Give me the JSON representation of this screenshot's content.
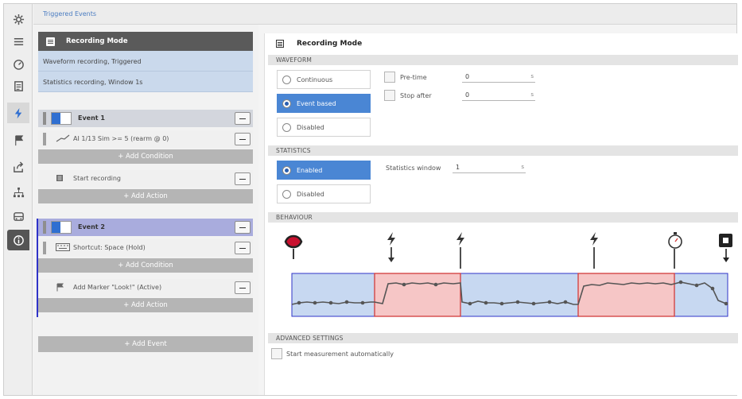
{
  "breadcrumb": "Triggered Events",
  "rail": {
    "icons": [
      "gear-icon",
      "list-icon",
      "gauge-icon",
      "document-icon",
      "bolt-icon",
      "flag-icon",
      "export-icon",
      "network-icon",
      "car-icon",
      "info-icon"
    ]
  },
  "left": {
    "recording_mode": {
      "title": "Recording Mode",
      "rows": [
        "Waveform recording, Triggered",
        "Statistics recording, Window 1s"
      ]
    },
    "events": [
      {
        "title": "Event 1",
        "condition": "AI 1/13 Sim >= 5 (rearm @ 0)",
        "add_condition": "+ Add Condition",
        "action": "Start recording",
        "add_action": "+ Add Action"
      },
      {
        "title": "Event 2",
        "condition": "Shortcut: Space (Hold)",
        "add_condition": "+ Add Condition",
        "action": "Add Marker \"Look!\" (Active)",
        "add_action": "+ Add Action"
      }
    ],
    "add_event": "+ Add Event"
  },
  "right": {
    "title": "Recording Mode",
    "waveform": {
      "label": "WAVEFORM",
      "options": [
        "Continuous",
        "Event based",
        "Disabled"
      ],
      "selected": "Event based",
      "pre_time_label": "Pre-time",
      "pre_time_value": "0",
      "stop_after_label": "Stop after",
      "stop_after_value": "0",
      "unit": "s"
    },
    "statistics": {
      "label": "STATISTICS",
      "options": [
        "Enabled",
        "Disabled"
      ],
      "selected": "Enabled",
      "window_label": "Statistics window",
      "window_value": "1",
      "unit": "s"
    },
    "behaviour": {
      "label": "BEHAVIOUR"
    },
    "advanced": {
      "label": "ADVANCED SETTINGS",
      "auto_start_label": "Start measurement automatically"
    }
  },
  "colors": {
    "accent": "#2f6fd1",
    "selected_option": "#4a86d4",
    "event2_header": "#a9acdd",
    "behaviour_fill": "#c7d8f1",
    "behaviour_record": "#f6c6c6",
    "trigger_red": "#c8102e"
  }
}
